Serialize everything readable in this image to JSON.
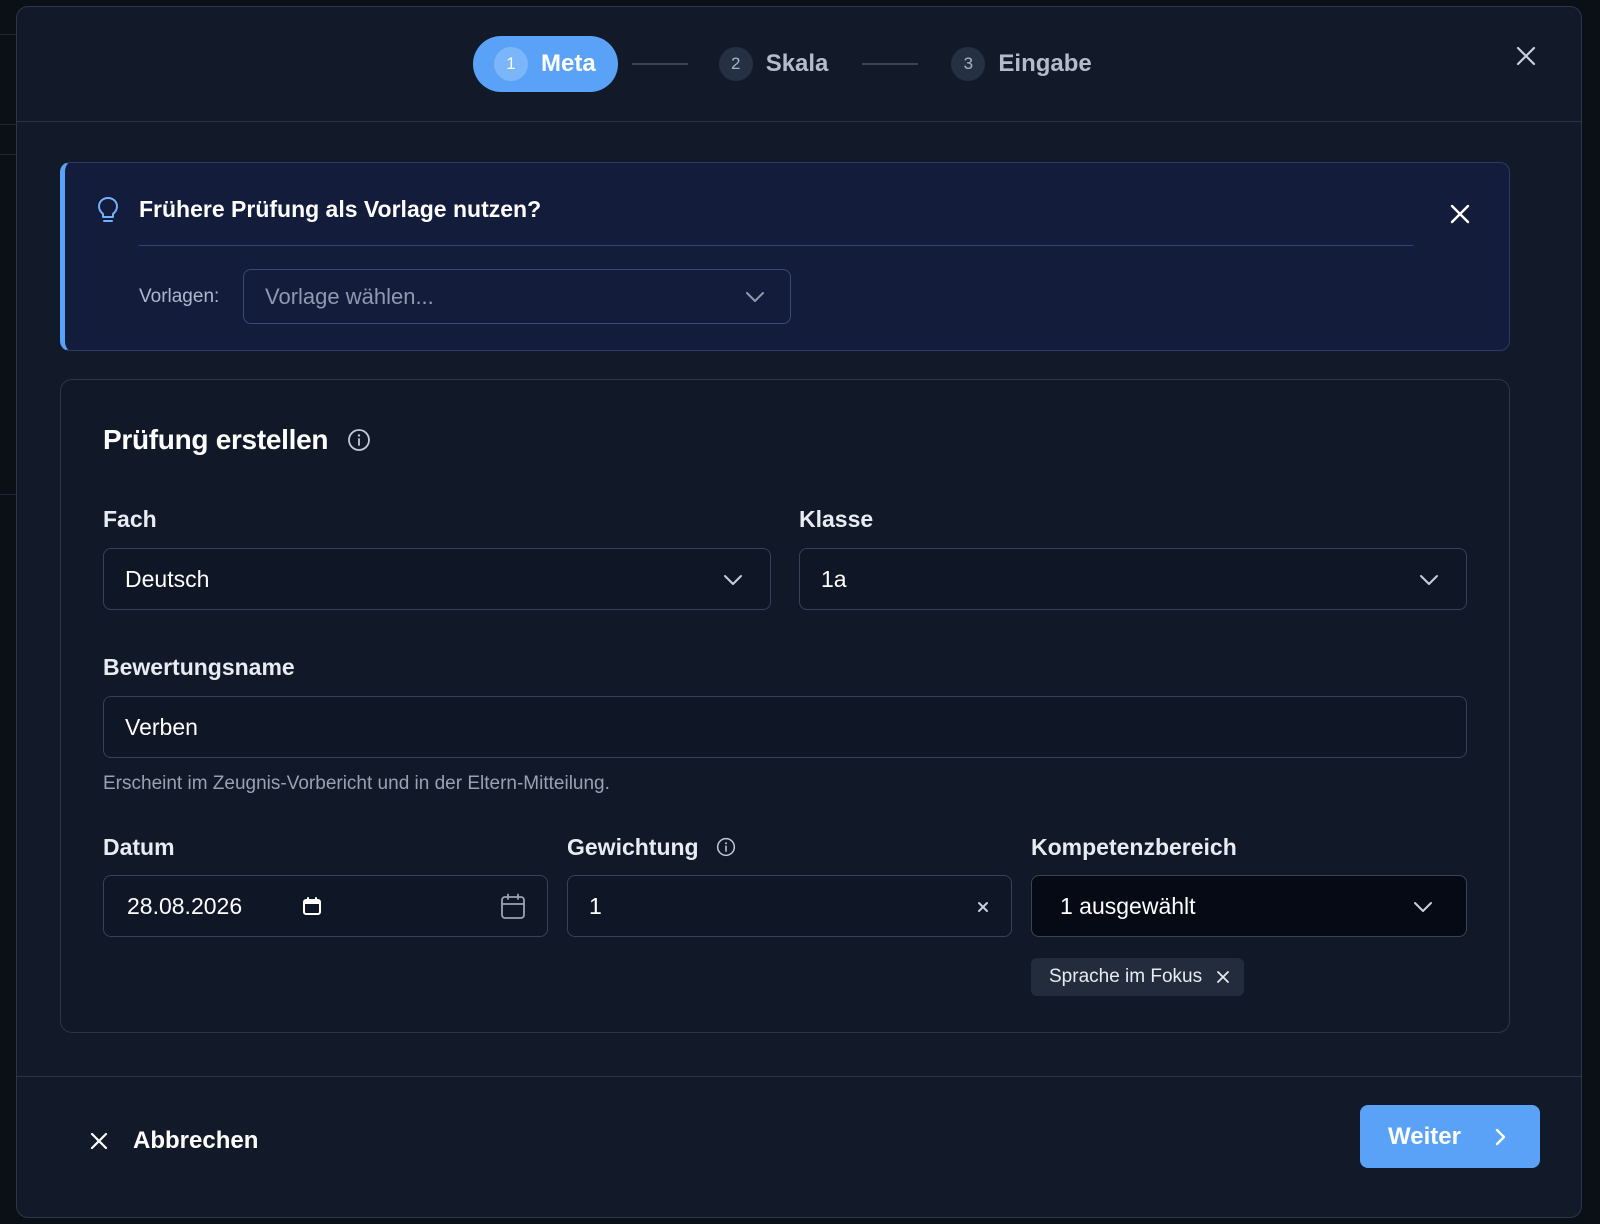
{
  "stepper": {
    "steps": [
      {
        "num": "1",
        "label": "Meta",
        "active": true
      },
      {
        "num": "2",
        "label": "Skala",
        "active": false
      },
      {
        "num": "3",
        "label": "Eingabe",
        "active": false
      }
    ]
  },
  "banner": {
    "title": "Frühere Prüfung als Vorlage nutzen?",
    "templates_label": "Vorlagen:",
    "templates_placeholder": "Vorlage wählen..."
  },
  "form": {
    "heading": "Prüfung erstellen",
    "subject": {
      "label": "Fach",
      "value": "Deutsch"
    },
    "class": {
      "label": "Klasse",
      "value": "1a"
    },
    "assessment_name": {
      "label": "Bewertungsname",
      "value": "Verben",
      "helper": "Erscheint im Zeugnis-Vorbericht und in der Eltern-Mitteilung."
    },
    "date": {
      "label": "Datum",
      "value": "28.08.2026"
    },
    "weighting": {
      "label": "Gewichtung",
      "value": "1"
    },
    "competence": {
      "label": "Kompetenzbereich",
      "value": "1 ausgewählt",
      "chips": [
        "Sprache im Fokus"
      ]
    }
  },
  "footer": {
    "cancel_label": "Abbrechen",
    "next_label": "Weiter"
  },
  "colors": {
    "accent": "#5aa2f7",
    "modal_bg": "#121a2a",
    "banner_bg": "#131d3b"
  }
}
